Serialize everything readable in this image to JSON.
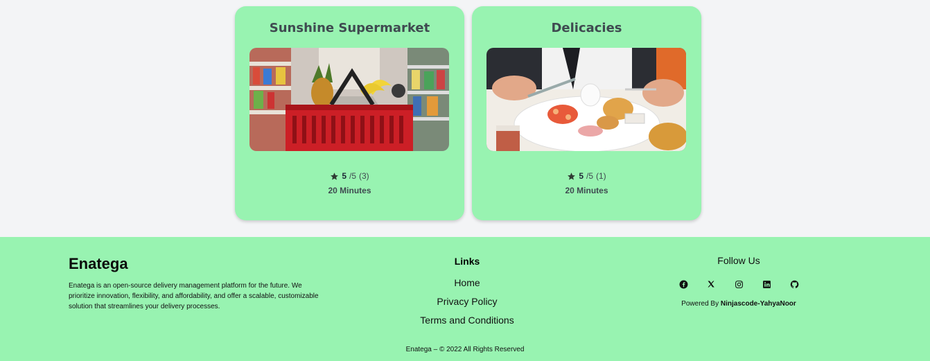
{
  "restaurants": [
    {
      "name": "Sunshine Supermarket",
      "image": "grocery-basket-image",
      "rating_value": "5",
      "rating_scale": "/5",
      "review_count": "(3)",
      "delivery_time": "20 Minutes"
    },
    {
      "name": "Delicacies",
      "image": "breakfast-plate-image",
      "rating_value": "5",
      "rating_scale": "/5",
      "review_count": "(1)",
      "delivery_time": "20 Minutes"
    }
  ],
  "footer": {
    "brand": "Enatega",
    "about": "Enatega is an open-source delivery management platform for the future. We prioritize innovation, flexibility, and affordability, and offer a scalable, customizable solution that streamlines your delivery processes.",
    "links_heading": "Links",
    "links": [
      "Home",
      "Privacy Policy",
      "Terms and Conditions"
    ],
    "follow_heading": "Follow Us",
    "socials": [
      "facebook-icon",
      "x-icon",
      "instagram-icon",
      "linkedin-icon",
      "github-icon"
    ],
    "powered_prefix": "Powered By ",
    "powered_name": "Ninjascode-YahyaNoor",
    "copyright": "Enatega – © 2022 All Rights Reserved"
  },
  "colors": {
    "card_bg": "#98f3b1",
    "page_bg": "#f3f4f6",
    "footer_bg": "#98f3b1"
  }
}
